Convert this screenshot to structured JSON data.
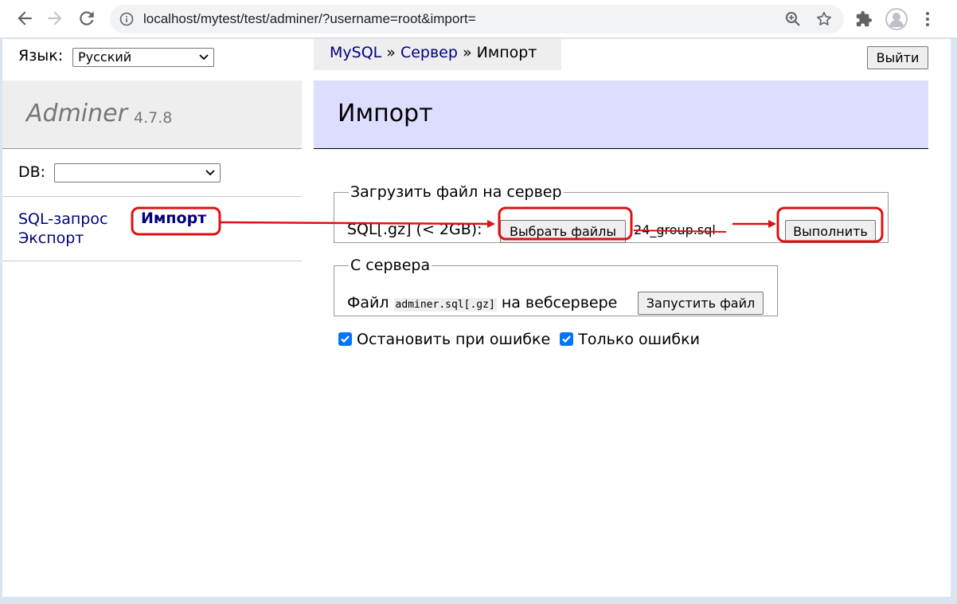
{
  "browser": {
    "url": "localhost/mytest/test/adminer/?username=root&import=",
    "icons": [
      "back-icon",
      "forward-icon",
      "reload-icon",
      "info-icon",
      "zoom-icon",
      "star-icon",
      "extensions-icon",
      "profile-icon",
      "menu-icon"
    ]
  },
  "sidebar": {
    "language_label": "Язык:",
    "language_value": "Русский",
    "brand_name": "Adminer",
    "brand_version": "4.7.8",
    "db_label": "DB:",
    "db_value": "",
    "links": {
      "sql": "SQL-запрос",
      "import": "Импорт",
      "export": "Экспорт"
    }
  },
  "header": {
    "breadcrumb": {
      "mysql": "MySQL",
      "sep": "»",
      "server": "Сервер",
      "current": "Импорт"
    },
    "logout": "Выйти",
    "title": "Импорт"
  },
  "upload": {
    "legend": "Загрузить файл на сервер",
    "label": "SQL[.gz] (< 2GB):",
    "choose_button": "Выбрать файлы",
    "file_name": "24_group.sql",
    "execute_button": "Выполнить"
  },
  "server": {
    "legend": "С сервера",
    "prefix": "Файл",
    "path": "adminer.sql[.gz]",
    "suffix": "на вебсервере",
    "run_button": "Запустить файл"
  },
  "options": {
    "stop_on_error": {
      "label": "Остановить при ошибке",
      "checked": true
    },
    "only_errors": {
      "label": "Только ошибки",
      "checked": true
    }
  },
  "colors": {
    "link": "#000080",
    "heading_bg": "#ddddff",
    "annotation": "#dd1111",
    "checkbox": "#0075ff"
  }
}
